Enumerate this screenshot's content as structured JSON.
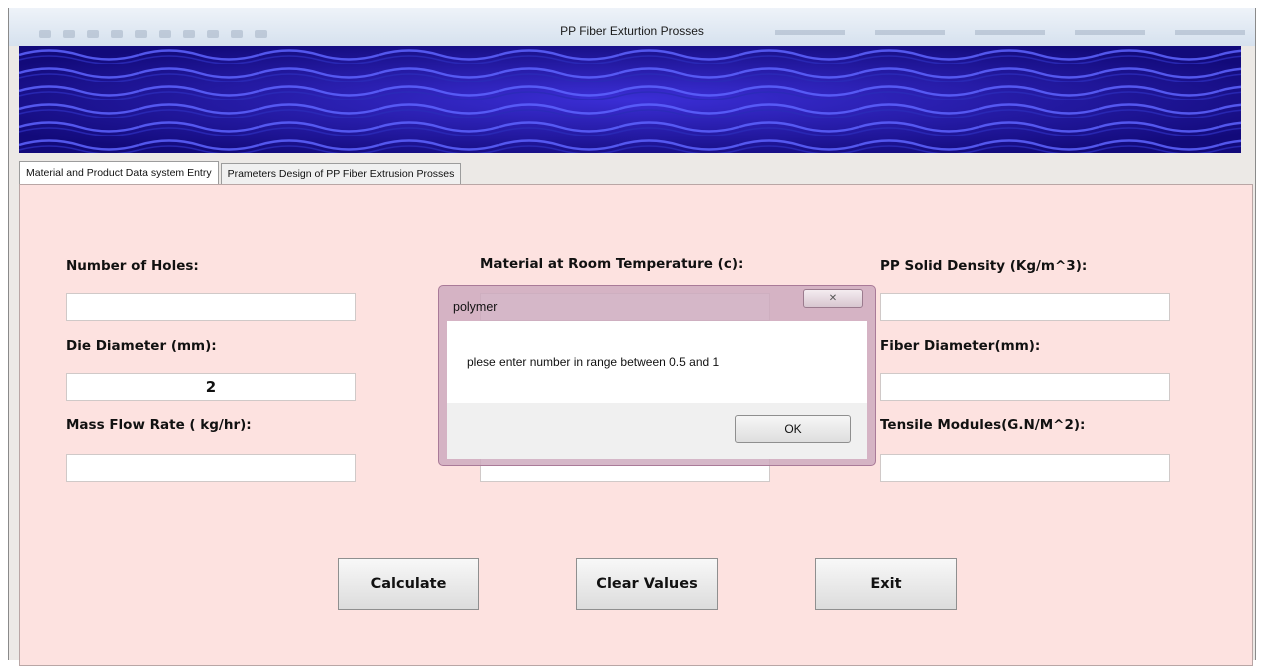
{
  "window": {
    "title": "PP Fiber Exturtion Prosses"
  },
  "tabs": [
    {
      "label": "Material and Product Data system Entry"
    },
    {
      "label": "Prameters Design of PP Fiber Extrusion Prosses"
    }
  ],
  "form": {
    "number_of_holes": {
      "label": "Number of Holes:",
      "value": ""
    },
    "die_diameter": {
      "label": "Die Diameter (mm):",
      "value": "2"
    },
    "mass_flow_rate": {
      "label": "Mass Flow Rate ( kg/hr):",
      "value": ""
    },
    "material_room_temp": {
      "label": "Material at Room Temperature (c):",
      "value": ""
    },
    "field_middle_3": {
      "value": ""
    },
    "pp_solid_density": {
      "label": "PP Solid Density (Kg/m^3):",
      "value": ""
    },
    "fiber_diameter": {
      "label": "Fiber Diameter(mm):",
      "value": ""
    },
    "tensile_modules": {
      "label": "Tensile Modules(G.N/M^2):",
      "value": ""
    }
  },
  "buttons": {
    "calculate": "Calculate",
    "clear": "Clear Values",
    "exit": "Exit"
  },
  "dialog": {
    "title": "polymer",
    "message": "plese enter  number in range between  0.5 and 1",
    "ok": "OK",
    "close_icon": "close-icon"
  },
  "colors": {
    "panel_bg": "#fde2e0",
    "banner_bg": "#16108c",
    "dialog_frame": "#ceaabe"
  }
}
